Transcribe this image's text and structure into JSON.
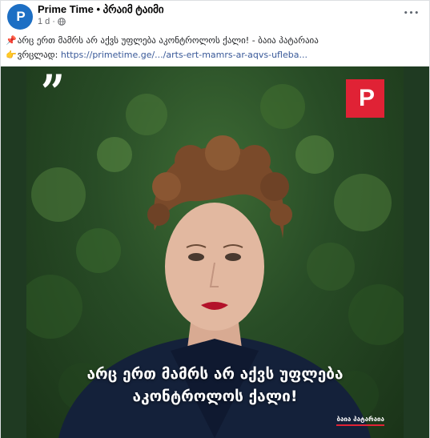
{
  "post": {
    "page_name": "Prime Time • პრაიმ ტაიმი",
    "timestamp": "1 d",
    "separator": "·",
    "privacy_icon": "globe-icon",
    "more_icon": "more-horizontal-icon",
    "more_label": "•••",
    "avatar_label": "P",
    "caption": {
      "line1_icon": "📌",
      "line1_text": "არც ერთ მამრს არ აქვს უფლება აკონტროლოს ქალი! - ბაია პატარაია",
      "line2_icon": "👉",
      "line2_prefix": "ვრცლად: ",
      "link_text": "https://primetime.ge/.../arts-ert-mamrs-ar-aqvs-ufleba..."
    }
  },
  "media": {
    "quote_mark": "”",
    "logo_label": "P",
    "headline_line1": "არც ერთ მამრს არ აქვს უფლება",
    "headline_line2": "აკონტროლოს ქალი!",
    "signature": "ბაია პატარაია"
  },
  "colors": {
    "brand_blue": "#1d6fc4",
    "logo_red": "#e02235",
    "link": "#385898",
    "meta_gray": "#65676b",
    "background_green": "#284c26"
  }
}
